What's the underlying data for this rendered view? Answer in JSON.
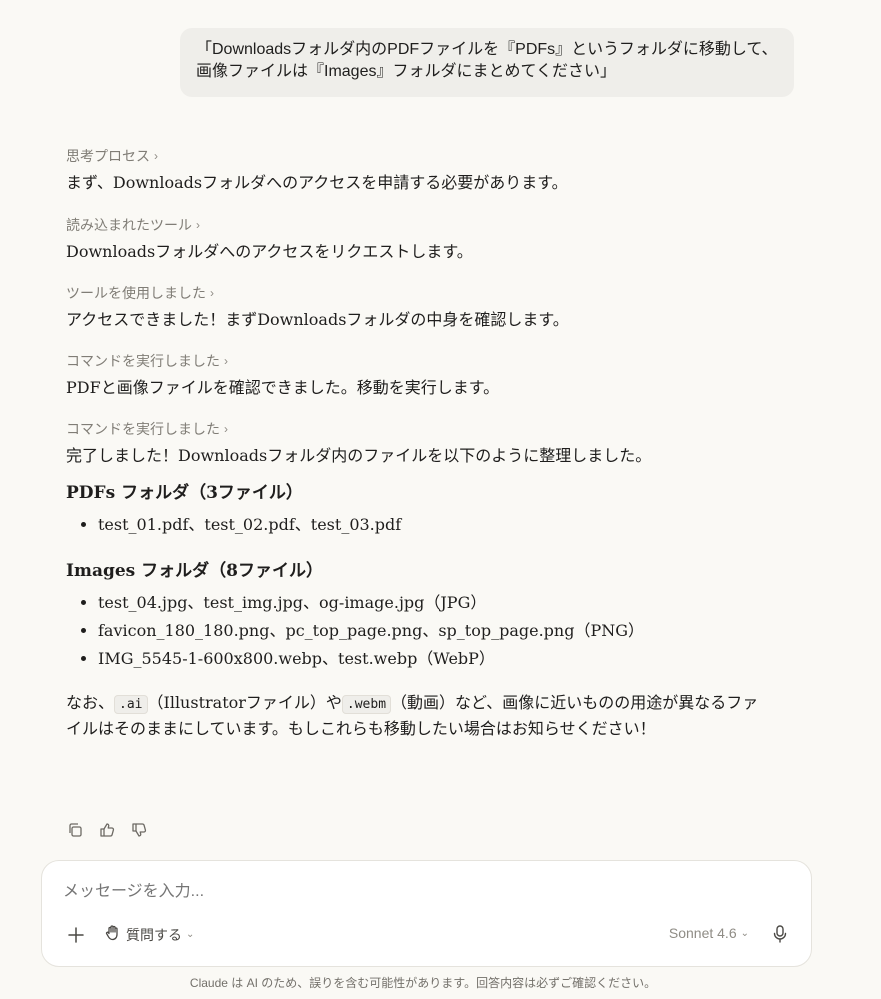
{
  "user_message": {
    "line1": "「Downloadsフォルダ内のPDFファイルを『PDFs』というフォルダに移動して、",
    "line2": "画像ファイルは『Images』フォルダにまとめてください」"
  },
  "assistant": {
    "steps": [
      {
        "label": "思考プロセス",
        "text": "まず、Downloadsフォルダへのアクセスを申請する必要があります。"
      },
      {
        "label": "読み込まれたツール",
        "text": "Downloadsフォルダへのアクセスをリクエストします。"
      },
      {
        "label": "ツールを使用しました",
        "text": "アクセスできました！まずDownloadsフォルダの中身を確認します。"
      },
      {
        "label": "コマンドを実行しました",
        "text": "PDFと画像ファイルを確認できました。移動を実行します。"
      },
      {
        "label": "コマンドを実行しました",
        "text": "完了しました！Downloadsフォルダ内のファイルを以下のように整理しました。"
      }
    ],
    "pdfs_heading": "PDFs フォルダ（3ファイル）",
    "pdfs_items": [
      "test_01.pdf、test_02.pdf、test_03.pdf"
    ],
    "images_heading": "Images フォルダ（8ファイル）",
    "images_items": [
      "test_04.jpg、test_img.jpg、og-image.jpg（JPG）",
      "favicon_180_180.png、pc_top_page.png、sp_top_page.png（PNG）",
      "IMG_5545-1-600x800.webp、test.webp（WebP）"
    ],
    "note": {
      "pre": "なお、",
      "code1": ".ai",
      "mid1": "（Illustratorファイル）や",
      "code2": ".webm",
      "mid2": "（動画）など、画像に近いものの用途が異なるファ",
      "line2": "イルはそのままにしています。もしこれらも移動したい場合はお知らせください！"
    }
  },
  "actions": {
    "icons": [
      "copy-icon",
      "thumbs-up-icon",
      "thumbs-down-icon"
    ]
  },
  "composer": {
    "placeholder": "メッセージを入力...",
    "ask_label": "質問する",
    "model_label": "Sonnet 4.6"
  },
  "disclaimer": "Claude は AI のため、誤りを含む可能性があります。回答内容は必ずご確認ください。"
}
